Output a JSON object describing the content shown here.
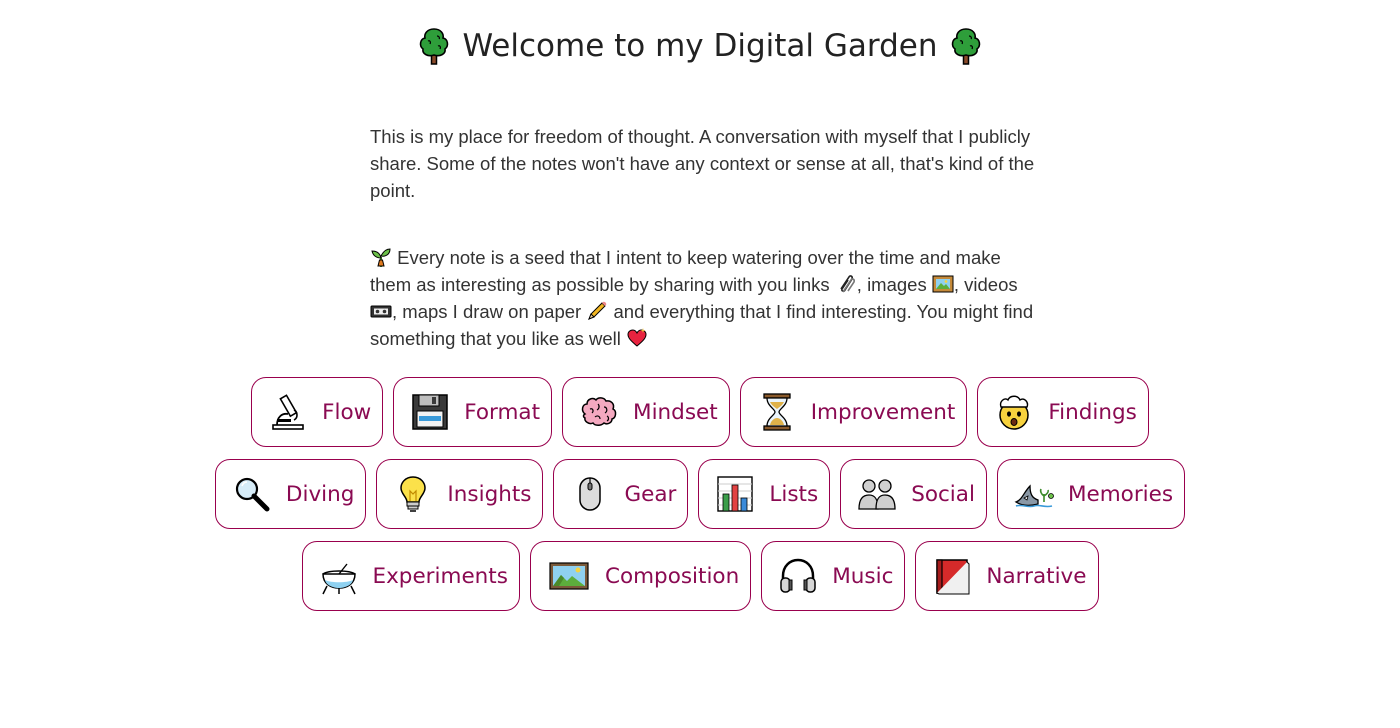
{
  "header": {
    "title": "Welcome to my Digital Garden",
    "left_icon": "tree-icon",
    "right_icon": "tree-icon"
  },
  "intro": {
    "paragraph1": "This is my place for freedom of thought. A conversation with myself that I publicly share. Some of the notes won't have any context or sense at all, that's kind of the point.",
    "p2_part1": "Every note is a seed that I intent to keep watering over the time and make them as interesting as possible by sharing with you links",
    "p2_part2": ", images",
    "p2_part3": ", videos",
    "p2_part4": ", maps I draw on paper",
    "p2_part5": "and everything that I find interesting. You might find something that you like as well"
  },
  "colors": {
    "accent": "#99004d",
    "label": "#8a0a52",
    "text": "#333333"
  },
  "tags": {
    "row1": [
      {
        "label": "Flow",
        "icon": "microscope-icon"
      },
      {
        "label": "Format",
        "icon": "floppy-disk-icon"
      },
      {
        "label": "Mindset",
        "icon": "brain-icon"
      },
      {
        "label": "Improvement",
        "icon": "hourglass-icon"
      },
      {
        "label": "Findings",
        "icon": "exploding-head-icon"
      }
    ],
    "row2": [
      {
        "label": "Diving",
        "icon": "magnifying-glass-icon"
      },
      {
        "label": "Insights",
        "icon": "light-bulb-icon"
      },
      {
        "label": "Gear",
        "icon": "computer-mouse-icon"
      },
      {
        "label": "Lists",
        "icon": "bar-chart-icon"
      },
      {
        "label": "Social",
        "icon": "people-icon"
      },
      {
        "label": "Memories",
        "icon": "shark-icon"
      }
    ],
    "row3": [
      {
        "label": "Experiments",
        "icon": "satellite-dish-icon"
      },
      {
        "label": "Composition",
        "icon": "framed-picture-icon"
      },
      {
        "label": "Music",
        "icon": "headphones-icon"
      },
      {
        "label": "Narrative",
        "icon": "closed-book-icon"
      }
    ]
  }
}
